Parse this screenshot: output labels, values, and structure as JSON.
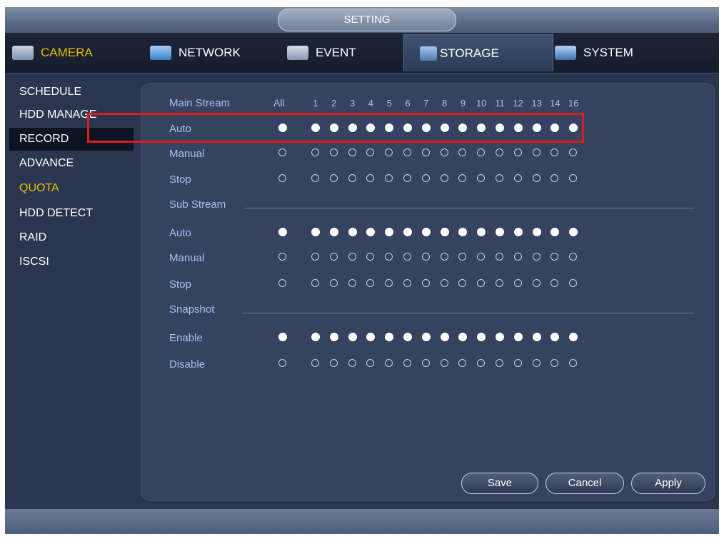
{
  "window": {
    "title": "SETTING"
  },
  "tabs": [
    {
      "label": "CAMERA",
      "icon": "camera-icon",
      "color": "#e6c200"
    },
    {
      "label": "NETWORK",
      "icon": "network-icon"
    },
    {
      "label": "EVENT",
      "icon": "event-icon"
    },
    {
      "label": "STORAGE",
      "icon": "storage-icon",
      "active": true
    },
    {
      "label": "SYSTEM",
      "icon": "system-icon"
    }
  ],
  "sidebar": {
    "items": [
      {
        "label": "SCHEDULE"
      },
      {
        "label": "HDD MANAGE"
      },
      {
        "label": "RECORD",
        "selected": true
      },
      {
        "label": "ADVANCE"
      },
      {
        "label": "QUOTA",
        "color": "#e6c200"
      },
      {
        "label": "HDD DETECT"
      },
      {
        "label": "RAID"
      },
      {
        "label": "ISCSI"
      }
    ]
  },
  "record": {
    "main_stream_label": "Main Stream",
    "all_label": "All",
    "channels": [
      "1",
      "2",
      "3",
      "4",
      "5",
      "6",
      "7",
      "8",
      "9",
      "10",
      "11",
      "12",
      "13",
      "14",
      "16"
    ],
    "main_stream": {
      "rows": [
        {
          "label": "Auto",
          "selected": true
        },
        {
          "label": "Manual",
          "selected": false
        },
        {
          "label": "Stop",
          "selected": false
        }
      ]
    },
    "sub_stream": {
      "label": "Sub Stream",
      "rows": [
        {
          "label": "Auto",
          "selected": true
        },
        {
          "label": "Manual",
          "selected": false
        },
        {
          "label": "Stop",
          "selected": false
        }
      ]
    },
    "snapshot": {
      "label": "Snapshot",
      "rows": [
        {
          "label": "Enable",
          "selected": true
        },
        {
          "label": "Disable",
          "selected": false
        }
      ]
    }
  },
  "buttons": {
    "save": "Save",
    "cancel": "Cancel",
    "apply": "Apply"
  },
  "colors": {
    "accent": "#e6c200",
    "highlight": "#e01b1b",
    "label": "#a9c2ee"
  }
}
